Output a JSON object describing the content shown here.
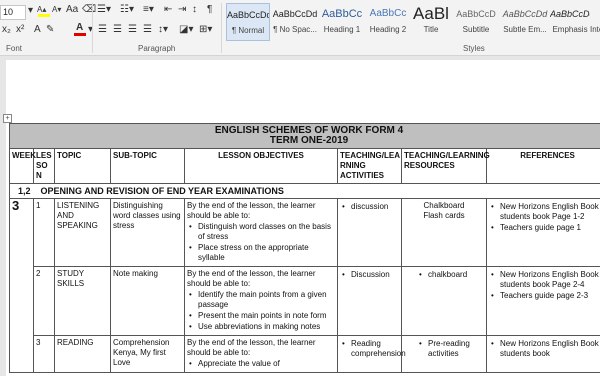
{
  "ribbon": {
    "font_size": "10",
    "font_group_label": "Font",
    "paragraph_group_label": "Paragraph",
    "styles_group_label": "Styles",
    "styles": [
      {
        "preview": "AaBbCcDd",
        "name": "¶ Normal"
      },
      {
        "preview": "AaBbCcDd",
        "name": "¶ No Spac..."
      },
      {
        "preview": "AaBbCc",
        "name": "Heading 1"
      },
      {
        "preview": "AaBbCc",
        "name": "Heading 2"
      },
      {
        "preview": "AaBl",
        "name": "Title"
      },
      {
        "preview": "AaBbCcD",
        "name": "Subtitle"
      },
      {
        "preview": "AaBbCcDd",
        "name": "Subtle Em..."
      },
      {
        "preview": "AaBbCcDd",
        "name": "Emphasis"
      },
      {
        "preview": "",
        "name": "Inte"
      }
    ]
  },
  "doc": {
    "title1": "ENGLISH SCHEMES OF WORK FORM 4",
    "title2": "TERM ONE-2019",
    "headers": {
      "week": "WEEK",
      "lesson": "LES SO N",
      "topic": "TOPIC",
      "subtopic": "SUB-TOPIC",
      "objectives": "LESSON OBJECTIVES",
      "activities": "TEACHING/LEA RNING ACTIVITIES",
      "resources": "TEACHING/LEARNING RESOURCES",
      "references": "REFERENCES"
    },
    "section_lesson": "1,2",
    "section_title": "OPENING AND REVISION OF END YEAR EXAMINATIONS",
    "week_number": "3",
    "rows": [
      {
        "lesson": "1",
        "topic": "LISTENING AND SPEAKING",
        "subtopic": "Distinguishing word classes using stress",
        "obj_intro": "By the end of the lesson, the learner should be able to:",
        "obj1": "Distinguish word classes on the basis of stress",
        "obj2": "Place stress on the appropriate syllable",
        "activity": "discussion",
        "res1": "Chalkboard",
        "res2": "Flash cards",
        "ref1": "New Horizons English Book 4 students book Page 1-2",
        "ref2": "Teachers guide page 1"
      },
      {
        "lesson": "2",
        "topic": "STUDY SKILLS",
        "subtopic": "Note making",
        "obj_intro": "By the end of the lesson, the learner should be able to:",
        "obj1": "Identify the main points from a given passage",
        "obj2": "Present the main points in note form",
        "obj3": "Use abbreviations in making notes",
        "activity": "Discussion",
        "res1": "chalkboard",
        "ref1": "New Horizons English Book 4 students book Page 2-4",
        "ref2": "Teachers guide page 2-3"
      },
      {
        "lesson": "3",
        "topic": "READING",
        "subtopic": "Comprehension Kenya, My first Love",
        "obj_intro": "By the end of the lesson, the learner should be able to:",
        "obj1": "Appreciate the value of",
        "activity": "Reading comprehension",
        "res1": "Pre-reading activities",
        "ref1": "New Horizons English Book 4 students book"
      }
    ]
  }
}
